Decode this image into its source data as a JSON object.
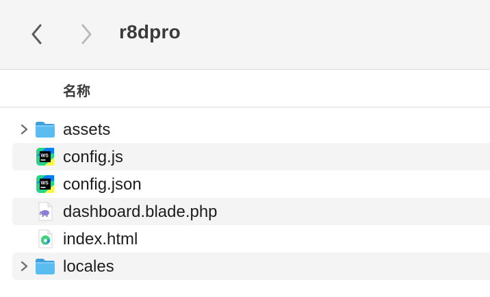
{
  "window": {
    "title": "r8dpro"
  },
  "header": {
    "name_column": "名称"
  },
  "files": [
    {
      "name": "assets",
      "icon": "folder-icon",
      "expandable": true
    },
    {
      "name": "config.js",
      "icon": "webstorm-file-icon",
      "expandable": false
    },
    {
      "name": "config.json",
      "icon": "webstorm-file-icon",
      "expandable": false
    },
    {
      "name": "dashboard.blade.php",
      "icon": "php-file-icon",
      "expandable": false
    },
    {
      "name": "index.html",
      "icon": "edge-html-file-icon",
      "expandable": false
    },
    {
      "name": "locales",
      "icon": "folder-icon",
      "expandable": true
    }
  ],
  "colors": {
    "folder": "#4fb3ee",
    "folder_dark": "#3a9fdc",
    "row_alt": "#f4f4f5",
    "toolbar": "#f6f5f6"
  }
}
